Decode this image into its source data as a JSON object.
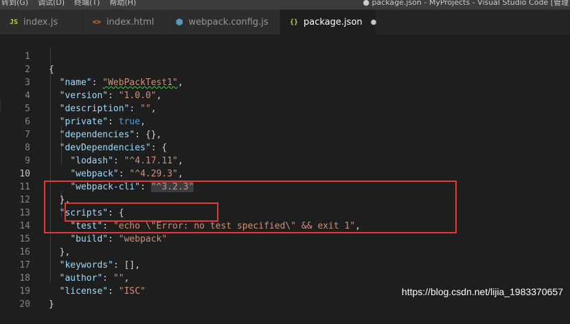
{
  "menu": [
    "转到(G)",
    "调试(D)",
    "终端(T)",
    "帮助(H)"
  ],
  "window_title": "● package.json - MyProjects - Visual Studio Code [管理",
  "tabs": [
    {
      "icon": "JS",
      "label": "index.js",
      "active": false
    },
    {
      "icon": "<>",
      "label": "index.html",
      "active": false
    },
    {
      "icon": "⬢",
      "label": "webpack.config.js",
      "active": false
    },
    {
      "icon": "{}",
      "label": "package.json",
      "active": true,
      "unsaved": "●"
    }
  ],
  "line_numbers": [
    "1",
    "2",
    "3",
    "4",
    "5",
    "6",
    "7",
    "8",
    "9",
    "10",
    "11",
    "12",
    "13",
    "14",
    "15",
    "16",
    "17",
    "18",
    "19",
    "20"
  ],
  "current_line": "10",
  "code": {
    "l1_brace": "{",
    "name_key": "\"name\"",
    "name_val": "\"WebPackTest1\"",
    "version_key": "\"version\"",
    "version_val": "\"1.0.0\"",
    "description_key": "\"description\"",
    "description_val": "\"\"",
    "private_key": "\"private\"",
    "private_val": "true",
    "dependencies_key": "\"dependencies\"",
    "dependencies_val": "{}",
    "devdeps_key": "\"devDependencies\"",
    "lodash_key": "\"lodash\"",
    "lodash_val": "\"^4.17.11\"",
    "webpack_key": "\"webpack\"",
    "webpack_val": "\"^4.29.3\"",
    "webpackcli_key": "\"webpack-cli\"",
    "webpackcli_val": "\"^3.2.3\"",
    "scripts_key": "\"scripts\"",
    "test_key": "\"test\"",
    "test_val": "\"echo \\\"Error: no test specified\\\" && exit 1\"",
    "build_key": "\"build\"",
    "build_val": "\"webpack\"",
    "keywords_key": "\"keywords\"",
    "keywords_val": "[]",
    "author_key": "\"author\"",
    "author_val": "\"\"",
    "license_key": "\"license\"",
    "license_val": "\"ISC\"",
    "close_brace": "}"
  },
  "watermark": "https://blog.csdn.net/lijia_1983370657",
  "colors": {
    "annotation_box": "#e53935",
    "string": "#ce9178",
    "key": "#9cdcfe",
    "keyword": "#569cd6"
  }
}
